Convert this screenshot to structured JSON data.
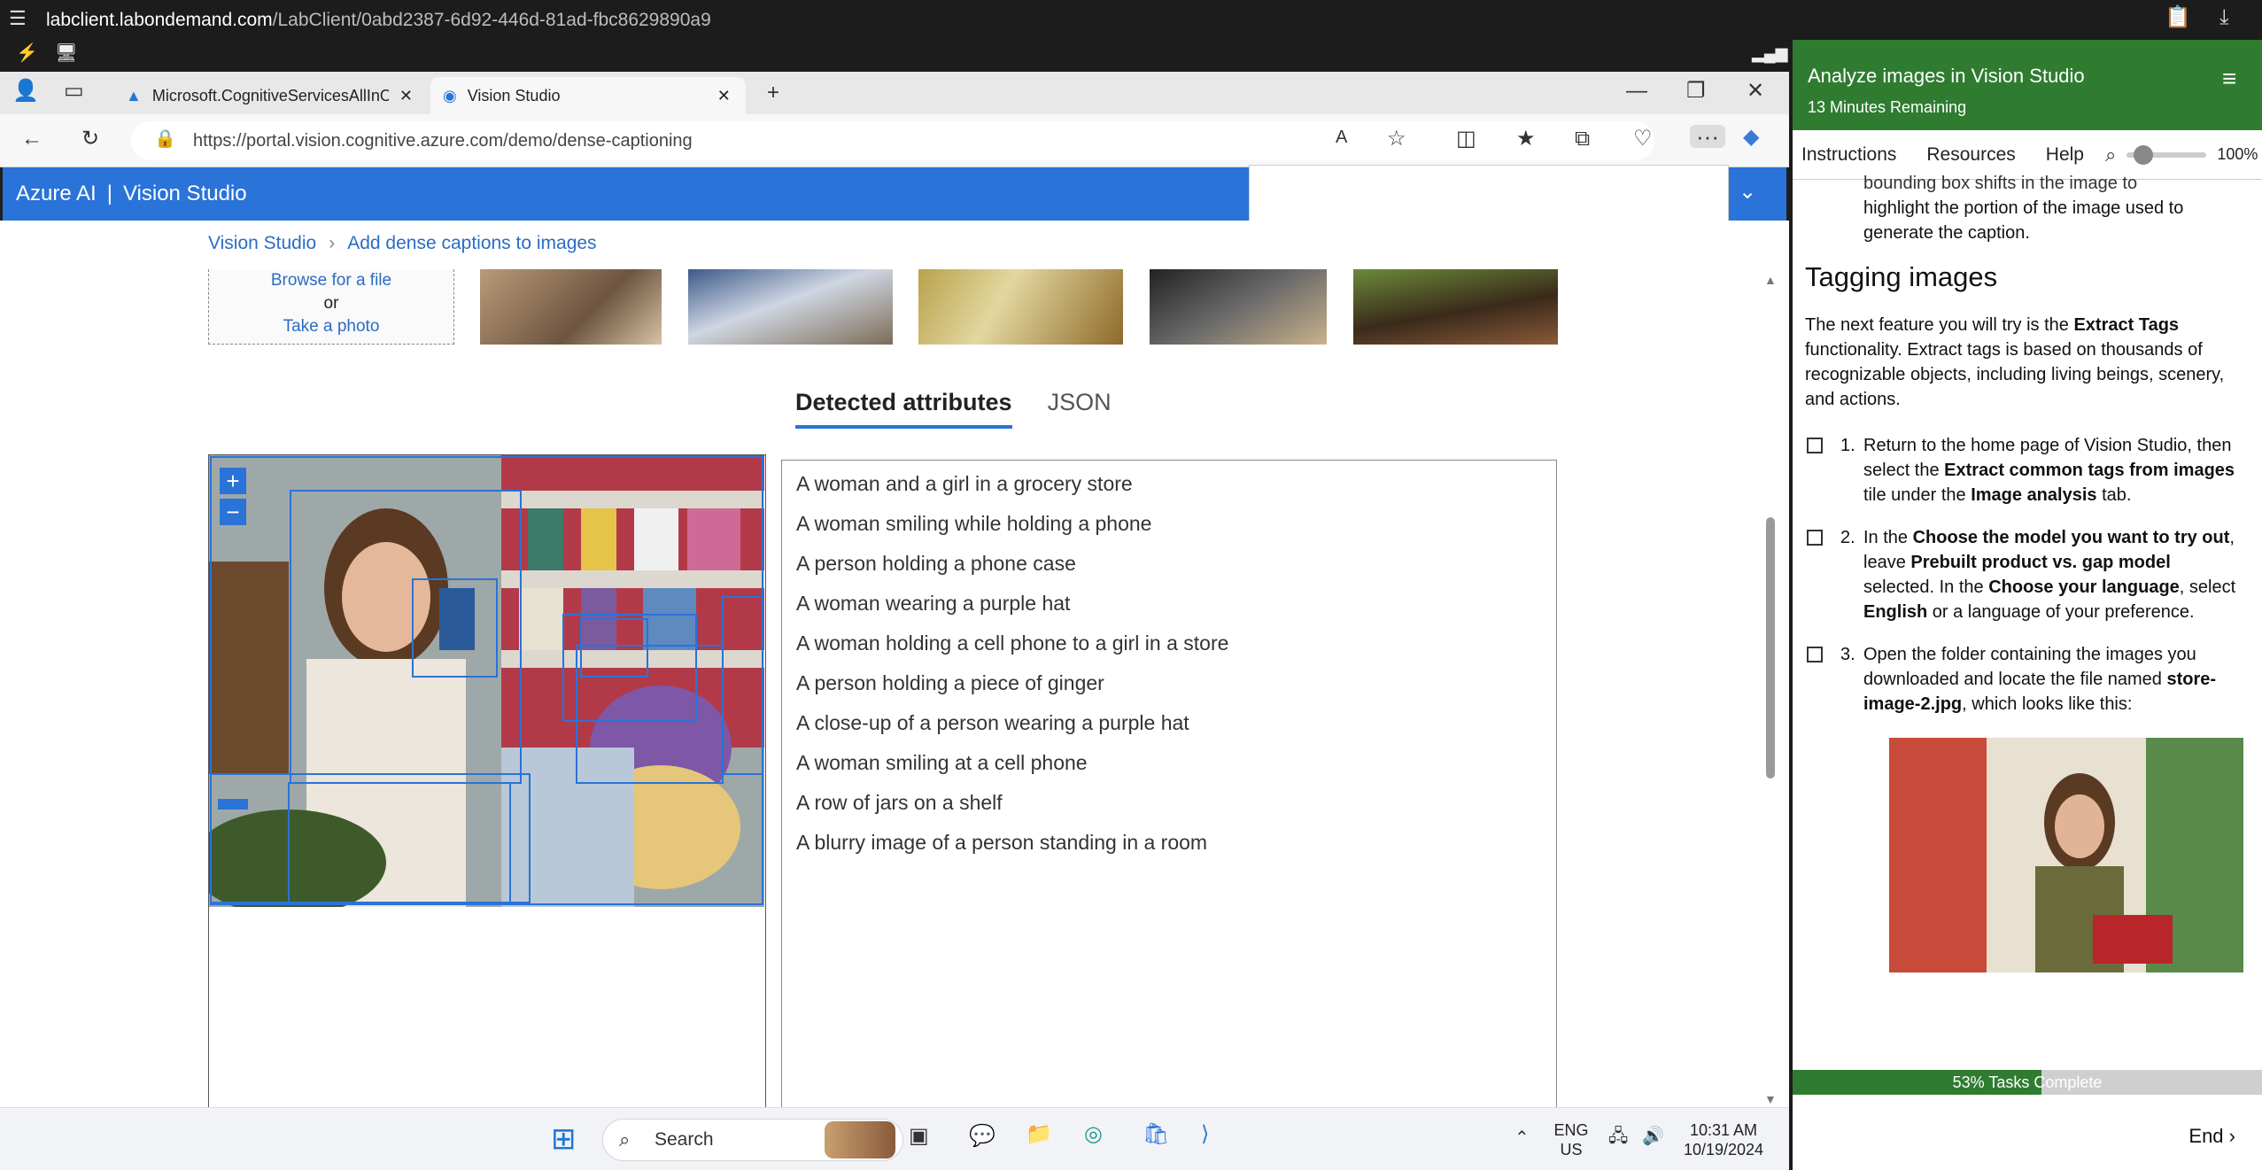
{
  "session": {
    "host": "labclient.labondemand.com",
    "path": "/LabClient/0abd2387-6d92-446d-81ad-fbc8629890a9"
  },
  "browser": {
    "tabs": [
      {
        "label": "Microsoft.CognitiveServicesAllInO"
      },
      {
        "label": "Vision Studio"
      }
    ],
    "url": "https://portal.vision.cognitive.azure.com/demo/dense-captioning"
  },
  "vision": {
    "brand": "Azure AI",
    "separator": "|",
    "product": "Vision Studio",
    "breadcrumb": [
      "Vision Studio",
      "Add dense captions to images"
    ],
    "upload": {
      "browse": "Browse for a file",
      "or": "or",
      "photo": "Take a photo"
    },
    "tabs": [
      "Detected attributes",
      "JSON"
    ],
    "captions": [
      "A woman and a girl in a grocery store",
      "A woman smiling while holding a phone",
      "A person holding a phone case",
      "A woman wearing a purple hat",
      "A woman holding a cell phone to a girl in a store",
      "A person holding a piece of ginger",
      "A close-up of a person wearing a purple hat",
      "A woman smiling at a cell phone",
      "A row of jars on a shelf",
      "A blurry image of a person standing in a room"
    ]
  },
  "taskbar": {
    "search": "Search",
    "lang": "ENG",
    "region": "US",
    "time": "10:31 AM",
    "date": "10/19/2024"
  },
  "lab": {
    "title": "Analyze images in Vision Studio",
    "remaining": "13 Minutes Remaining",
    "nav": [
      "Instructions",
      "Resources",
      "Help"
    ],
    "zoom": "100%",
    "prev_text_tail_1": "bounding box shifts in the image to",
    "prev_text_tail_2": "highlight the portion of the image used to generate the caption.",
    "heading": "Tagging images",
    "intro_a": "The next feature you will try is the ",
    "intro_b": "Extract Tags",
    "intro_c": " functionality. Extract tags is based on thousands of recognizable objects, including living beings, scenery, and actions.",
    "task1_num": "1.",
    "task1_a": "Return to the home page of Vision Studio, then select the ",
    "task1_b": "Extract common tags from images",
    "task1_c": " tile under the ",
    "task1_d": "Image analysis",
    "task1_e": " tab.",
    "task2_num": "2.",
    "task2_a": "In the ",
    "task2_b": "Choose the model you want to try out",
    "task2_c": ", leave ",
    "task2_d": "Prebuilt product vs. gap model",
    "task2_e": " selected. In the ",
    "task2_f": "Choose your language",
    "task2_g": ", select ",
    "task2_h": "English",
    "task2_i": " or a language of your preference.",
    "task3_num": "3.",
    "task3_a": "Open the folder containing the images you downloaded and locate the file named ",
    "task3_b": "store-image-2.jpg",
    "task3_c": ", which looks like this:",
    "progress_fraction": 0.53,
    "progress_text": "53% Tasks Complete",
    "end": "End"
  },
  "colors": {
    "azure_blue": "#2a73d8",
    "lab_green": "#2f7c31"
  }
}
